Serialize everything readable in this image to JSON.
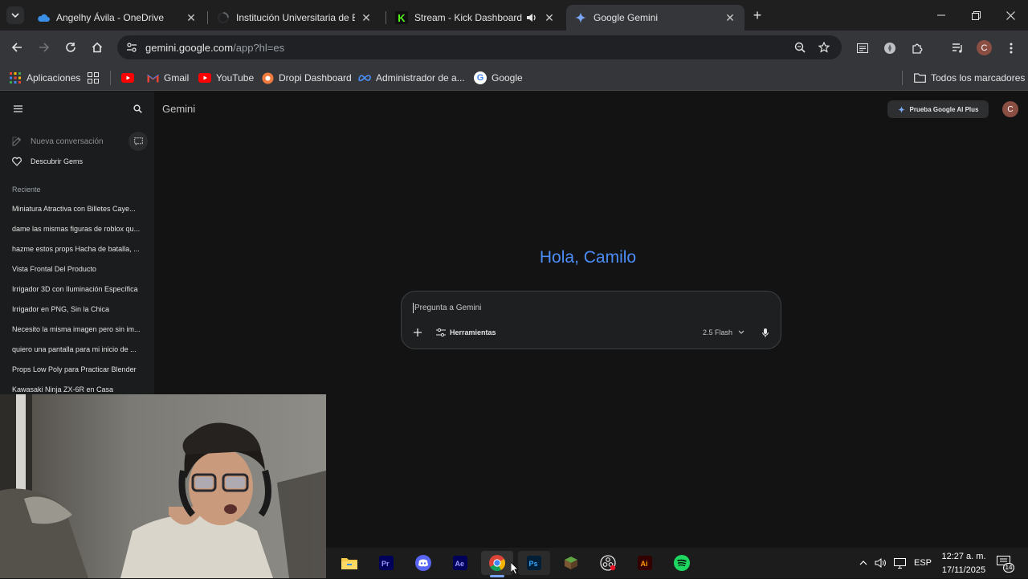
{
  "browser": {
    "tabs": [
      {
        "title": "Angelhy Ávila - OneDrive",
        "icon": "onedrive-cloud-icon"
      },
      {
        "title": "Institución Universitaria de Barr",
        "icon": "loading-spinner-icon"
      },
      {
        "title": "Stream - Kick Dashboard",
        "icon": "kick-logo-icon"
      },
      {
        "title": "Google Gemini",
        "icon": "gemini-logo-icon"
      }
    ],
    "address": {
      "host": "gemini.google.com",
      "path": "/app?hl=es"
    },
    "profile_initial": "C",
    "bookmarks": [
      {
        "label": "Aplicaciones",
        "icon": "apps-grid-icon"
      },
      {
        "label": "Gmail",
        "icon": "gmail-icon"
      },
      {
        "label": "YouTube",
        "icon": "youtube-icon"
      },
      {
        "label": "Dropi Dashboard",
        "icon": "dropi-icon"
      },
      {
        "label": "Administrador de a...",
        "icon": "meta-icon"
      },
      {
        "label": "Google",
        "icon": "google-g-icon"
      }
    ],
    "all_bookmarks": "Todos los marcadores"
  },
  "gemini": {
    "brand": "Gemini",
    "upgrade_button": "Prueba Google AI Plus",
    "avatar_initial": "C",
    "greeting": "Hola, Camilo",
    "prompt_placeholder": "Pregunta a Gemini",
    "tools_label": "Herramientas",
    "model_label": "2.5 Flash",
    "sidebar": {
      "new_chat": "Nueva conversación",
      "discover_gems": "Descubrir Gems",
      "recent_header": "Reciente",
      "recent": [
        "Miniatura Atractiva con Billetes Caye...",
        "dame las mismas figuras de roblox qu...",
        "hazme estos props Hacha de batalla, ...",
        "Vista Frontal Del Producto",
        "Irrigador 3D con Iluminación Específica",
        "Irrigador en PNG, Sin la Chica",
        "Necesito la misma imagen pero sin im...",
        "quiero una pantalla para mi inicio de ...",
        "Props Low Poly para Practicar Blender",
        "Kawasaki Ninja ZX-6R en Casa"
      ]
    }
  },
  "taskbar": {
    "apps": [
      "file-explorer-icon",
      "premiere-pro-icon",
      "discord-icon",
      "after-effects-icon",
      "chrome-icon",
      "photoshop-icon",
      "minecraft-icon",
      "obs-icon",
      "illustrator-icon",
      "spotify-icon"
    ],
    "language": "ESP",
    "time": "12:27 a. m.",
    "date": "17/11/2025",
    "notifications": "14"
  },
  "colors": {
    "accent_blue": "#4c8df6",
    "chrome_dark": "#1f1f1f",
    "toolbar": "#35363a",
    "gemini_bg": "#131314"
  }
}
